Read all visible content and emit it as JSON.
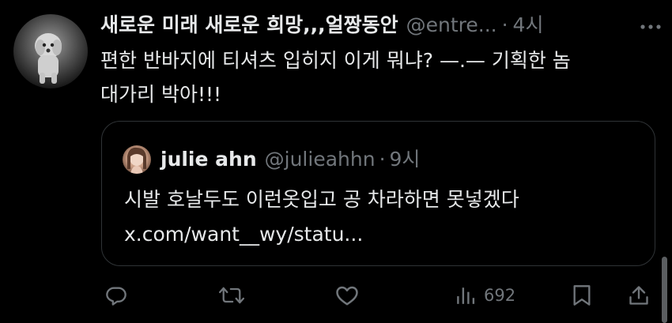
{
  "tweet": {
    "author_name": "새로운 미래 새로운 희망,,,얼짱동안",
    "handle": "@entre...",
    "separator": "·",
    "time": "4시",
    "text_line1": "편한 반바지에 티셔츠 입히지 이게 뭐냐? —.— 기획한 놈",
    "text_line2": "대가리 박아!!!"
  },
  "quoted_tweet": {
    "author_name": "julie ahn",
    "handle": "@julieahhn",
    "separator": "·",
    "time": "9시",
    "text_line1": "시발 호날두도 이런옷입고 공 차라하면 못넣겠다",
    "text_line2": "x.com/want__wy/statu..."
  },
  "actions": {
    "views_count": "692"
  },
  "icons": {
    "more": "more-icon",
    "reply": "reply-icon",
    "retweet": "retweet-icon",
    "like": "like-icon",
    "views": "views-icon",
    "bookmark": "bookmark-icon",
    "share": "share-icon"
  },
  "colors": {
    "background": "#000000",
    "primary_text": "#e7e9ea",
    "secondary_text": "#71767b",
    "border": "#2f3336"
  }
}
